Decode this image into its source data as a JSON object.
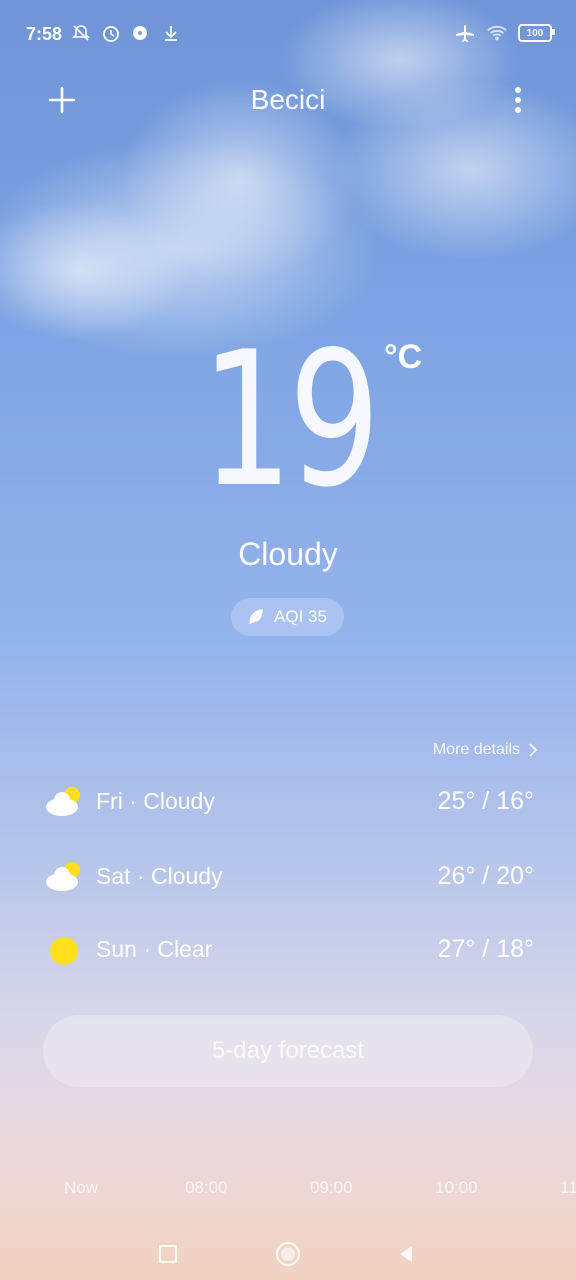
{
  "status": {
    "time": "7:58",
    "battery": "100"
  },
  "header": {
    "city": "Becici",
    "add_icon": "plus-icon",
    "menu_icon": "more-vertical-icon"
  },
  "current": {
    "temperature": "19",
    "unit": "°C",
    "condition": "Cloudy",
    "aqi_label": "AQI 35",
    "aqi_icon": "leaf-icon"
  },
  "details": {
    "more_label": "More details"
  },
  "daily": [
    {
      "label": "Fri · Cloudy",
      "range": "25° / 16°",
      "icon": "partly-cloudy-icon"
    },
    {
      "label": "Sat · Cloudy",
      "range": "26° / 20°",
      "icon": "partly-cloudy-icon"
    },
    {
      "label": "Sun · Clear",
      "range": "27° / 18°",
      "icon": "sun-icon"
    }
  ],
  "forecast_button": "5-day forecast",
  "hourly": [
    "Now",
    "08:00",
    "09:00",
    "10:00",
    "11"
  ],
  "colors": {
    "sun": "#ffe01a",
    "sky_top": "#6f95d8",
    "sky_bottom": "#f2d2c0"
  }
}
